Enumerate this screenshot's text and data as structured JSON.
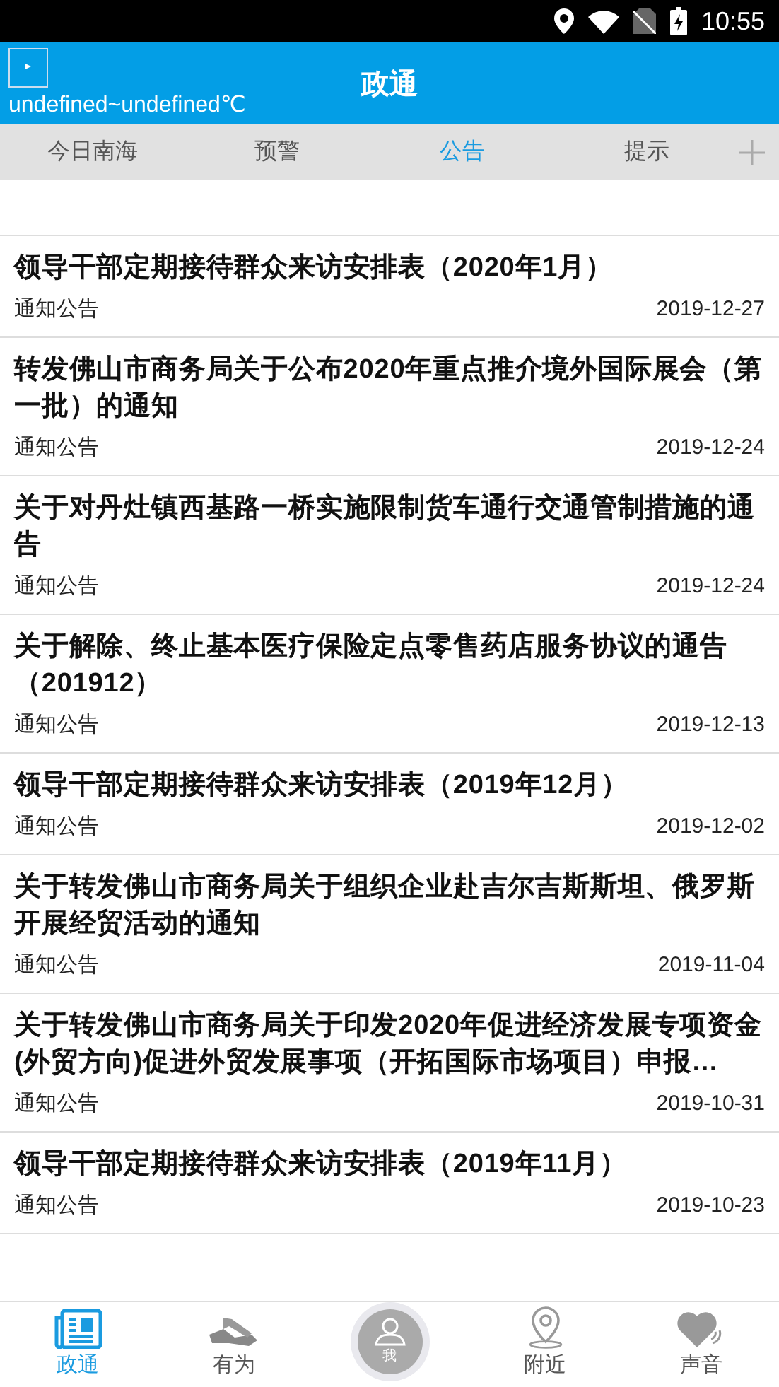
{
  "status_bar": {
    "time": "10:55"
  },
  "header": {
    "weather": "undefined~undefined℃",
    "title": "政通"
  },
  "tabs": [
    {
      "label": "今日南海",
      "selected": false
    },
    {
      "label": "预警",
      "selected": false
    },
    {
      "label": "公告",
      "selected": true
    },
    {
      "label": "提示",
      "selected": false
    }
  ],
  "articles": [
    {
      "title": "领导干部定期接待群众来访安排表（2020年1月）",
      "category": "通知公告",
      "date": "2019-12-27"
    },
    {
      "title": "转发佛山市商务局关于公布2020年重点推介境外国际展会（第一批）的通知",
      "category": "通知公告",
      "date": "2019-12-24"
    },
    {
      "title": "关于对丹灶镇西基路一桥实施限制货车通行交通管制措施的通告",
      "category": "通知公告",
      "date": "2019-12-24"
    },
    {
      "title": "关于解除、终止基本医疗保险定点零售药店服务协议的通告（201912）",
      "category": "通知公告",
      "date": "2019-12-13"
    },
    {
      "title": "领导干部定期接待群众来访安排表（2019年12月）",
      "category": "通知公告",
      "date": "2019-12-02"
    },
    {
      "title": "关于转发佛山市商务局关于组织企业赴吉尔吉斯斯坦、俄罗斯开展经贸活动的通知",
      "category": "通知公告",
      "date": "2019-11-04"
    },
    {
      "title": "关于转发佛山市商务局关于印发2020年促进经济发展专项资金(外贸方向)促进外贸发展事项（开拓国际市场项目）申报…",
      "category": "通知公告",
      "date": "2019-10-31"
    },
    {
      "title": "领导干部定期接待群众来访安排表（2019年11月）",
      "category": "通知公告",
      "date": "2019-10-23"
    }
  ],
  "bottom_nav": [
    {
      "kind": "news",
      "label": "政通",
      "selected": true
    },
    {
      "kind": "hands",
      "label": "有为",
      "selected": false
    },
    {
      "kind": "me",
      "label": "我",
      "selected": false
    },
    {
      "kind": "pin",
      "label": "附近",
      "selected": false
    },
    {
      "kind": "heart",
      "label": "声音",
      "selected": false
    }
  ]
}
